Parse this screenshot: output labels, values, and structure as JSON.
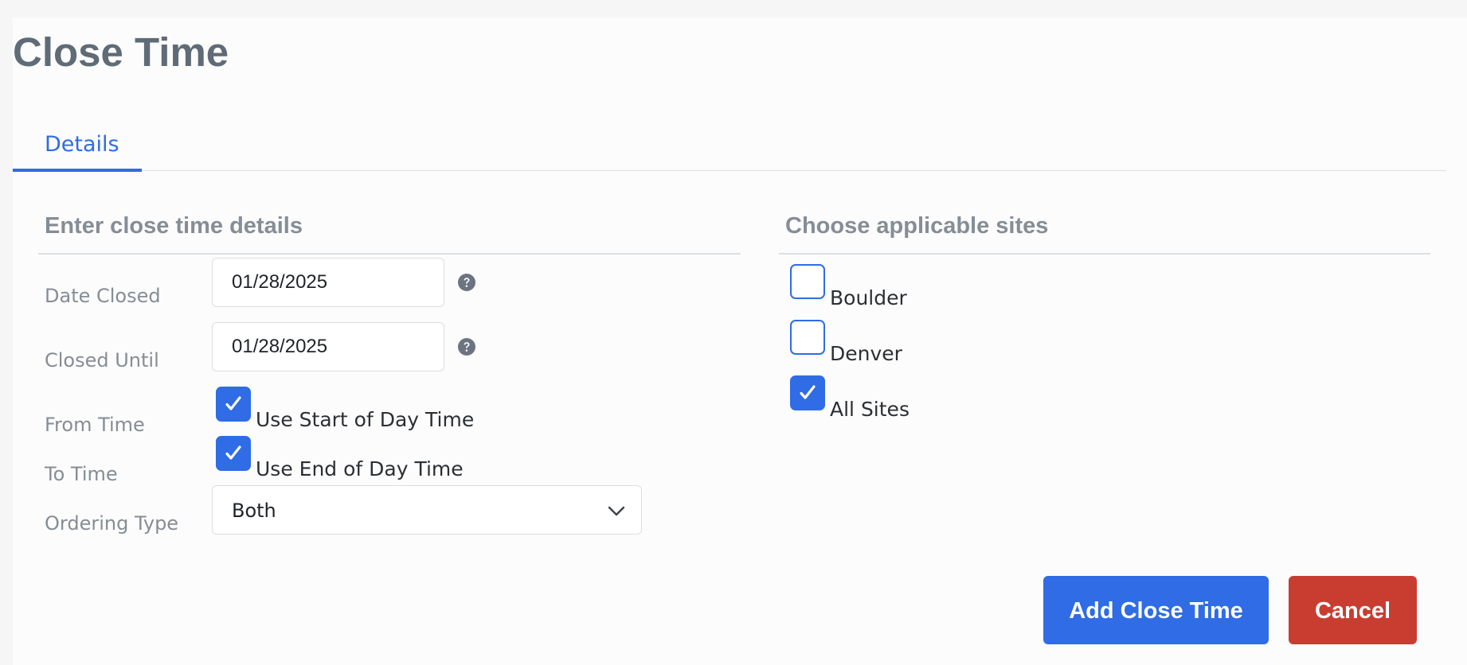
{
  "page": {
    "title": "Close Time"
  },
  "tabs": [
    {
      "label": "Details",
      "active": true
    }
  ],
  "details_section": {
    "title": "Enter close time details",
    "date_closed": {
      "label": "Date Closed",
      "value": "01/28/2025",
      "help_icon": "question-circle-icon"
    },
    "closed_until": {
      "label": "Closed Until",
      "value": "01/28/2025",
      "help_icon": "question-circle-icon"
    },
    "from_time": {
      "label": "From Time",
      "checkbox_label": "Use Start of Day Time",
      "checked": true
    },
    "to_time": {
      "label": "To Time",
      "checkbox_label": "Use End of Day Time",
      "checked": true
    },
    "ordering_type": {
      "label": "Ordering Type",
      "selected": "Both",
      "icon": "chevron-down-icon"
    }
  },
  "sites_section": {
    "title": "Choose applicable sites",
    "sites": [
      {
        "label": "Boulder",
        "checked": false
      },
      {
        "label": "Denver",
        "checked": false
      },
      {
        "label": "All Sites",
        "checked": true
      }
    ]
  },
  "actions": {
    "primary_label": "Add Close Time",
    "cancel_label": "Cancel"
  },
  "colors": {
    "accent": "#2f6ce5",
    "danger": "#c93d31",
    "title": "#5f6b77",
    "label": "#858d96"
  }
}
